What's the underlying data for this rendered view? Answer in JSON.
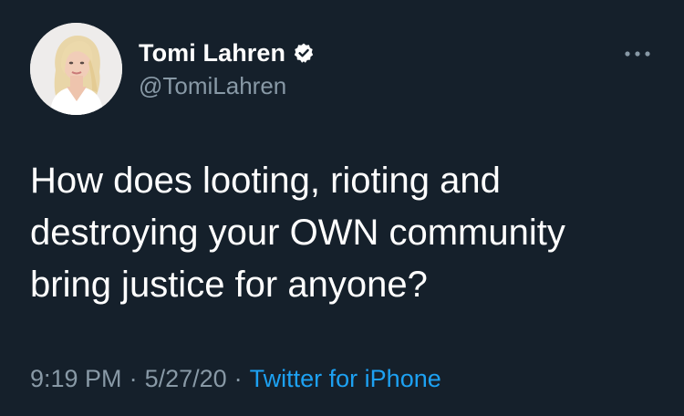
{
  "author": {
    "display_name": "Tomi Lahren",
    "handle": "@TomiLahren",
    "verified": true
  },
  "tweet": {
    "lines": [
      "How does looting, rioting and",
      "destroying your OWN community",
      "bring justice for anyone?"
    ]
  },
  "meta": {
    "time": "9:19 PM",
    "date": "5/27/20",
    "source": "Twitter for iPhone",
    "separator": "·"
  },
  "icons": {
    "verified": "verified-badge-icon",
    "more": "more-options-icon"
  },
  "colors": {
    "background": "#15202b",
    "text": "#ffffff",
    "secondary": "#8899a6",
    "link": "#1da1f2"
  }
}
